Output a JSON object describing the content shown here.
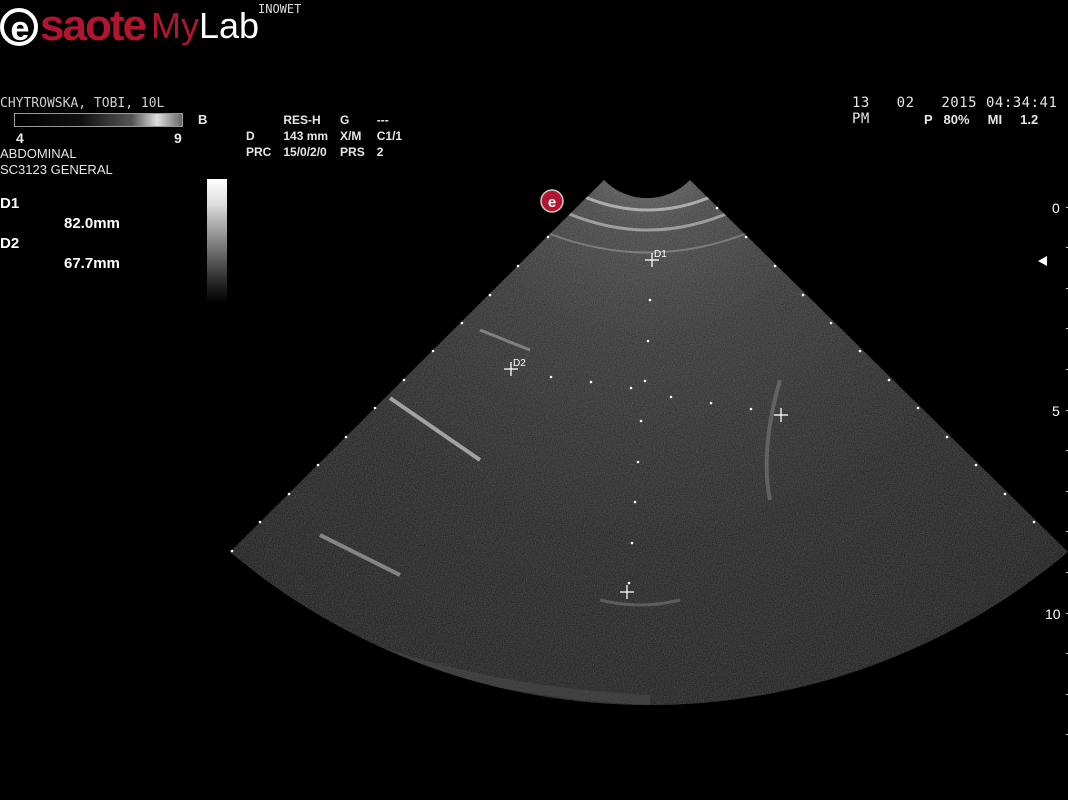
{
  "header": {
    "brand": "esaote",
    "brand_initial": "e",
    "brand_rest": "saote",
    "product_my": "My",
    "product_lab": "Lab",
    "institution": "INOWET"
  },
  "patient": {
    "name": "CHYTROWSKA, TOBI, 10L"
  },
  "gray_scale": {
    "low": "4",
    "high": "9",
    "mode": "B"
  },
  "preset": {
    "application": "ABDOMINAL",
    "probe": "SC3123  GENERAL"
  },
  "params": {
    "rows": [
      [
        "",
        "RES-H",
        "G",
        "---"
      ],
      [
        "D",
        "143 mm",
        "X/M",
        "C1/1"
      ],
      [
        "PRC",
        "15/0/2/0",
        "PRS",
        "2"
      ]
    ]
  },
  "datetime": {
    "day": "13",
    "month": "02",
    "year_time": "2015 04:34:41 PM"
  },
  "power": {
    "p_label": "P",
    "p_value": "80%",
    "mi_label": "MI",
    "mi_value": "1.2"
  },
  "measurements": [
    {
      "label": "D1",
      "value": "82.0mm"
    },
    {
      "label": "D2",
      "value": "67.7mm"
    }
  ],
  "caliper_labels": {
    "d1": "D1",
    "d2": "D2"
  },
  "depth_scale": [
    "0",
    "5",
    "10"
  ],
  "colors": {
    "brand_red": "#b2152f",
    "background": "#000000",
    "text": "#e6e6e6"
  }
}
